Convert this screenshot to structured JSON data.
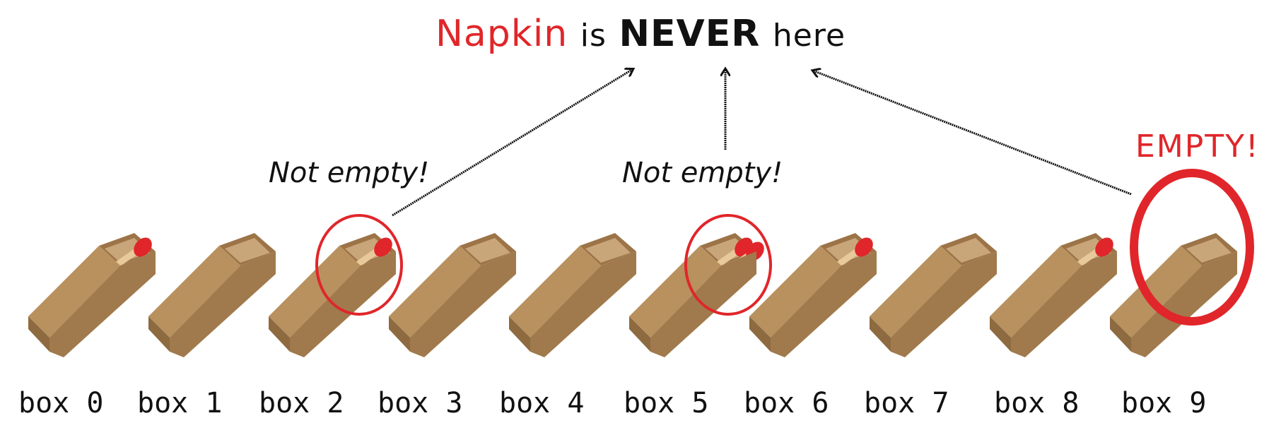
{
  "title": {
    "word1": "Napkin",
    "word2": "is",
    "word3": "NEVER",
    "word4": "here"
  },
  "annotations": {
    "not_empty_1": "Not empty!",
    "not_empty_2": "Not empty!",
    "empty": "EMPTY!"
  },
  "colors": {
    "accent_red": "#e0262a",
    "box_brown": "#b8915e",
    "text": "#111111"
  },
  "boxes": [
    {
      "label": "box 0",
      "matches": 1
    },
    {
      "label": "box 1",
      "matches": 0
    },
    {
      "label": "box 2",
      "matches": 1
    },
    {
      "label": "box 3",
      "matches": 0
    },
    {
      "label": "box 4",
      "matches": 0
    },
    {
      "label": "box 5",
      "matches": 2
    },
    {
      "label": "box 6",
      "matches": 1
    },
    {
      "label": "box 7",
      "matches": 0
    },
    {
      "label": "box 8",
      "matches": 1
    },
    {
      "label": "box 9",
      "matches": 0
    }
  ]
}
